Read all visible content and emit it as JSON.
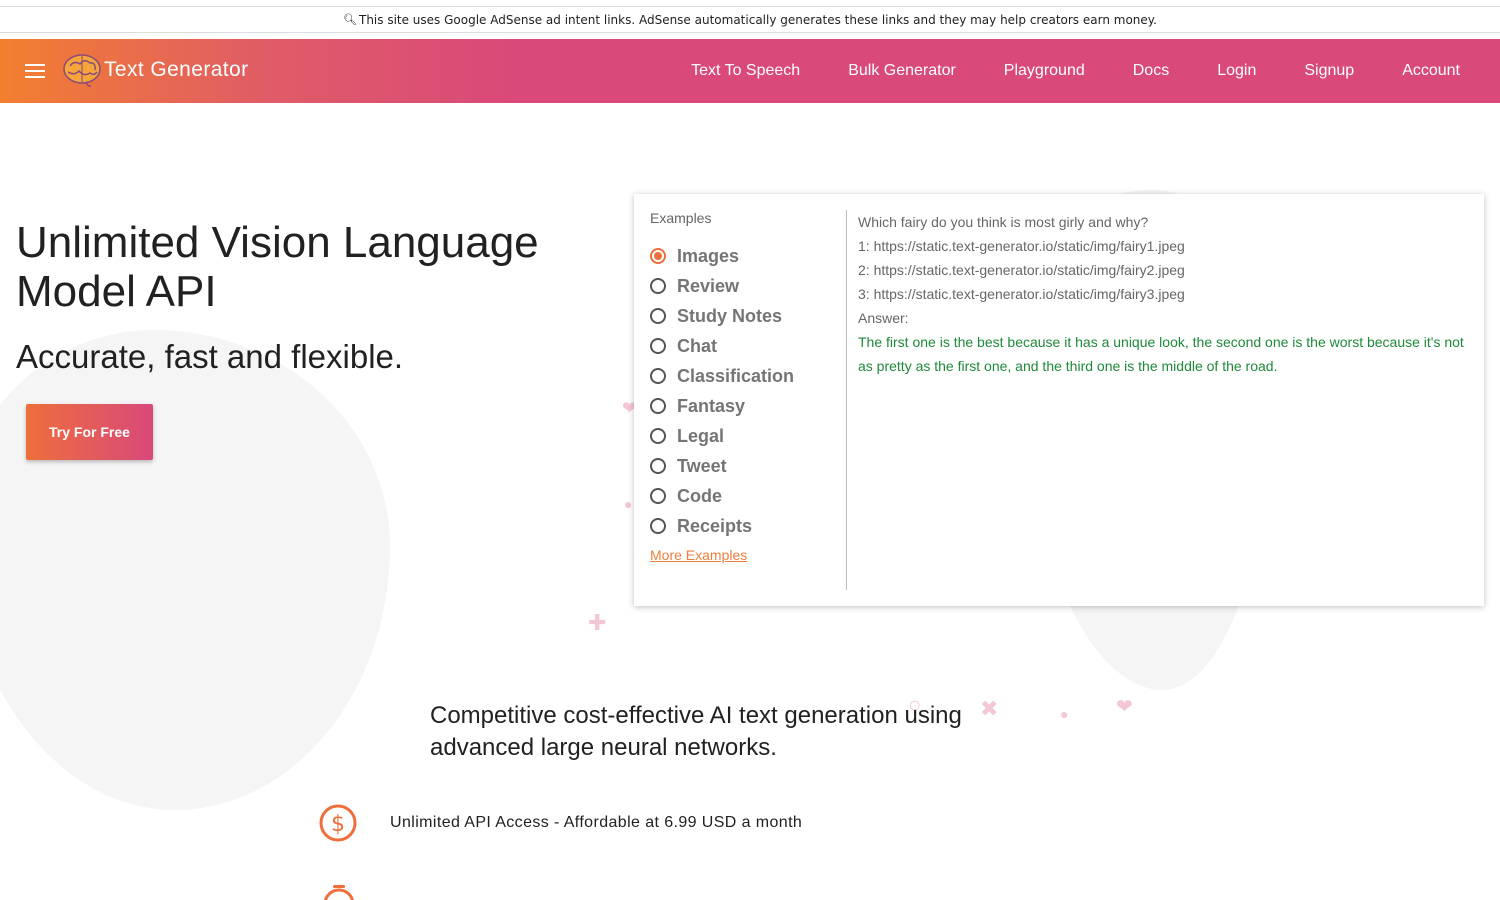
{
  "ad_bar": {
    "text": "This site uses Google AdSense ad intent links. AdSense automatically generates these links and they may help creators earn money."
  },
  "nav": {
    "brand": "Text Generator",
    "links": [
      "Text To Speech",
      "Bulk Generator",
      "Playground",
      "Docs",
      "Login",
      "Signup",
      "Account"
    ]
  },
  "hero": {
    "title": "Unlimited Vision Language Model API",
    "subtitle": "Accurate, fast and flexible.",
    "cta": "Try For Free"
  },
  "examples": {
    "heading": "Examples",
    "selected": "Images",
    "items": [
      "Images",
      "Review",
      "Study Notes",
      "Chat",
      "Classification",
      "Fantasy",
      "Legal",
      "Tweet",
      "Code",
      "Receipts"
    ],
    "more_link": "More Examples",
    "prompt_lines": [
      "Which fairy do you think is most girly and why?",
      "1: https://static.text-generator.io/static/img/fairy1.jpeg",
      "2: https://static.text-generator.io/static/img/fairy2.jpeg",
      "3: https://static.text-generator.io/static/img/fairy3.jpeg",
      "Answer:"
    ],
    "answer": "The first one is the best because it has a unique look, the second one is the worst because it's not as pretty as the first one, and the third one is the middle of the road."
  },
  "features": {
    "title": "Competitive cost-effective AI text generation using advanced large neural networks.",
    "items": [
      {
        "icon": "dollar-circle-icon",
        "text": "Unlimited API Access - Affordable at 6.99 USD a month"
      }
    ]
  },
  "colors": {
    "accent": "#ee6e3c",
    "brand_pink": "#d9497a",
    "answer_green": "#1e8a3a"
  }
}
